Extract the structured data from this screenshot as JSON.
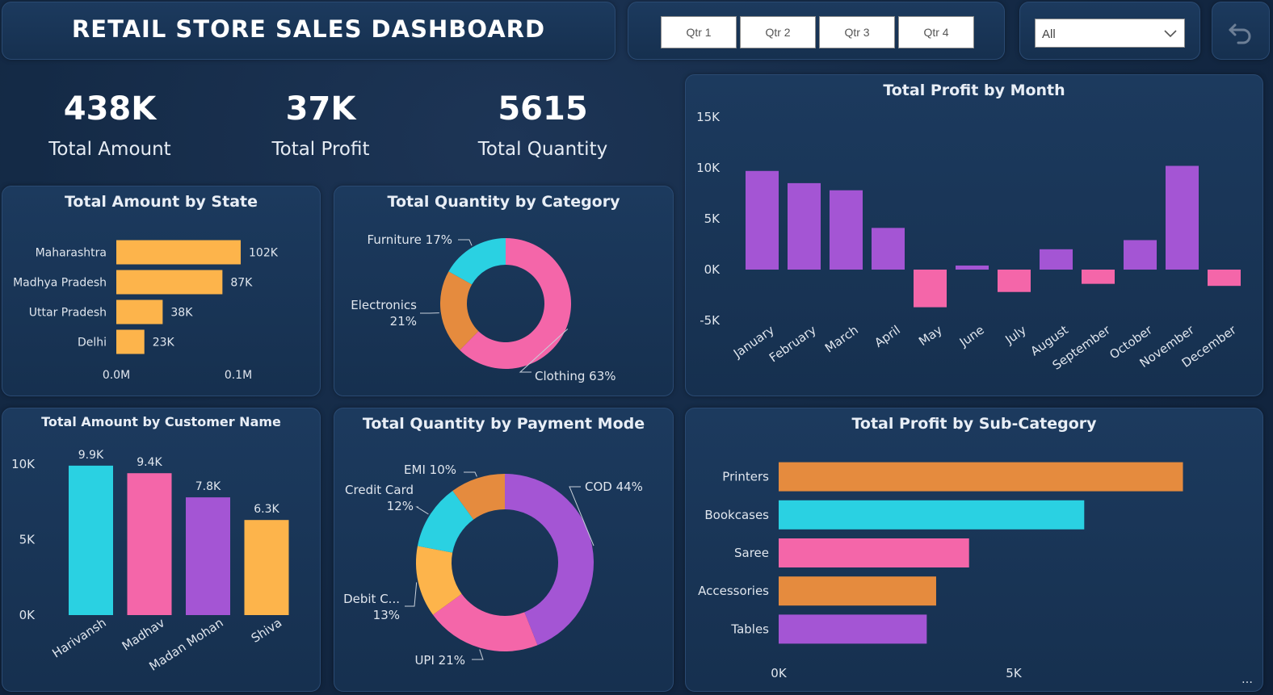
{
  "header": {
    "title": "RETAIL STORE SALES DASHBOARD"
  },
  "filters": {
    "quarters": [
      "Qtr 1",
      "Qtr 2",
      "Qtr 3",
      "Qtr 4"
    ],
    "dropdown_value": "All"
  },
  "kpis": [
    {
      "value": "438K",
      "label": "Total Amount"
    },
    {
      "value": "37K",
      "label": "Total Profit"
    },
    {
      "value": "5615",
      "label": "Total Quantity"
    }
  ],
  "colors": {
    "purple": "#a455d4",
    "pink": "#f466a9",
    "orange": "#e58b3e",
    "yellow": "#fdb44b",
    "cyan": "#2ad1e2",
    "label": "#e0e6ee",
    "axis": "#e0e6ee"
  },
  "chart_data": [
    {
      "id": "state",
      "type": "bar",
      "orientation": "horizontal",
      "title": "Total Amount by State",
      "categories": [
        "Maharashtra",
        "Madhya Pradesh",
        "Uttar Pradesh",
        "Delhi"
      ],
      "values": [
        102000,
        87000,
        38000,
        23000
      ],
      "data_labels": [
        "102K",
        "87K",
        "38K",
        "23K"
      ],
      "x_ticks": [
        "0.0M",
        "0.1M"
      ],
      "xlim": [
        0,
        100000
      ],
      "color": "#fdb44b"
    },
    {
      "id": "category",
      "type": "pie",
      "donut": true,
      "title": "Total Quantity by Category",
      "labels": [
        "Clothing",
        "Electronics",
        "Furniture"
      ],
      "values": [
        63,
        21,
        17
      ],
      "data_labels": [
        "Clothing 63%",
        "Electronics\n21%",
        "Furniture 17%"
      ],
      "colors": [
        "#f466a9",
        "#e58b3e",
        "#2ad1e2"
      ]
    },
    {
      "id": "month",
      "type": "bar",
      "title": "Total Profit by Month",
      "categories": [
        "January",
        "February",
        "March",
        "April",
        "May",
        "June",
        "July",
        "August",
        "September",
        "October",
        "November",
        "December"
      ],
      "values": [
        9700,
        8500,
        7800,
        4100,
        -3700,
        400,
        -2200,
        2000,
        -1400,
        2900,
        10200,
        -1600
      ],
      "y_ticks": [
        "15K",
        "10K",
        "5K",
        "0K",
        "-5K"
      ],
      "ylim": [
        -5000,
        15000
      ],
      "positive_color": "#a455d4",
      "negative_color": "#f466a9"
    },
    {
      "id": "customer",
      "type": "bar",
      "title": "Total Amount by Customer Name",
      "categories": [
        "Harivansh",
        "Madhav",
        "Madan Mohan",
        "Shiva"
      ],
      "values": [
        9900,
        9400,
        7800,
        6300
      ],
      "data_labels": [
        "9.9K",
        "9.4K",
        "7.8K",
        "6.3K"
      ],
      "y_ticks": [
        "10K",
        "5K",
        "0K"
      ],
      "ylim": [
        0,
        10000
      ],
      "colors": [
        "#2ad1e2",
        "#f466a9",
        "#a455d4",
        "#fdb44b"
      ]
    },
    {
      "id": "payment",
      "type": "pie",
      "donut": true,
      "title": "Total Quantity by Payment Mode",
      "labels": [
        "COD",
        "UPI",
        "Debit C...",
        "Credit Card",
        "EMI"
      ],
      "values": [
        44,
        21,
        13,
        12,
        10
      ],
      "data_labels": [
        "COD 44%",
        "UPI 21%",
        "Debit C...\n13%",
        "Credit Card\n12%",
        "EMI 10%"
      ],
      "colors": [
        "#a455d4",
        "#f466a9",
        "#fdb44b",
        "#2ad1e2",
        "#e58b3e"
      ]
    },
    {
      "id": "subcat",
      "type": "bar",
      "orientation": "horizontal",
      "title": "Total Profit by Sub-Category",
      "categories": [
        "Printers",
        "Bookcases",
        "Saree",
        "Accessories",
        "Tables"
      ],
      "values": [
        8600,
        6500,
        4050,
        3350,
        3150
      ],
      "x_ticks": [
        "0K",
        "5K"
      ],
      "xlim": [
        0,
        5000
      ],
      "colors": [
        "#e58b3e",
        "#2ad1e2",
        "#f466a9",
        "#e58b3e",
        "#a455d4"
      ]
    }
  ]
}
